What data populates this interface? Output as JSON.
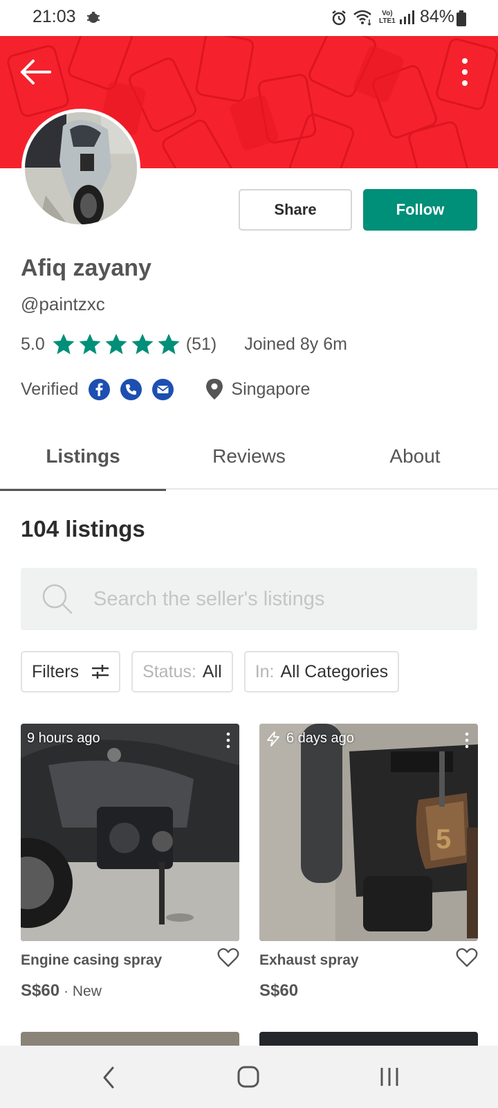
{
  "status_bar": {
    "time": "21:03",
    "volte_line1": "Vo)",
    "volte_line2": "LTE1",
    "battery": "84%"
  },
  "header": {
    "back_icon": "arrow-left-icon",
    "more_icon": "more-vertical-icon",
    "banner_color": "#f5222d"
  },
  "profile": {
    "name": "Afiq zayany",
    "handle": "@paintzxc",
    "rating": "5.0",
    "stars": 5,
    "review_count": "(51)",
    "joined": "Joined 8y 6m",
    "verified_label": "Verified",
    "verified_icons": [
      "facebook-icon",
      "phone-icon",
      "email-icon"
    ],
    "location": "Singapore"
  },
  "actions": {
    "share_label": "Share",
    "follow_label": "Follow",
    "follow_color": "#008f79"
  },
  "tabs": [
    {
      "label": "Listings",
      "active": true
    },
    {
      "label": "Reviews",
      "active": false
    },
    {
      "label": "About",
      "active": false
    }
  ],
  "listings": {
    "count_label": "104 listings",
    "search_placeholder": "Search the seller's listings",
    "filters_label": "Filters",
    "status_prefix": "Status:",
    "status_value": "All",
    "category_prefix": "In:",
    "category_value": "All Categories",
    "items": [
      {
        "time": "9 hours ago",
        "title": "Engine casing spray",
        "price": "S$60",
        "condition": "· New",
        "bumped": false
      },
      {
        "time": "6 days ago",
        "title": "Exhaust spray",
        "price": "S$60",
        "condition": "",
        "bumped": true
      }
    ]
  },
  "star_color": "#008f79",
  "verify_icon_color": "#1c4fb1"
}
